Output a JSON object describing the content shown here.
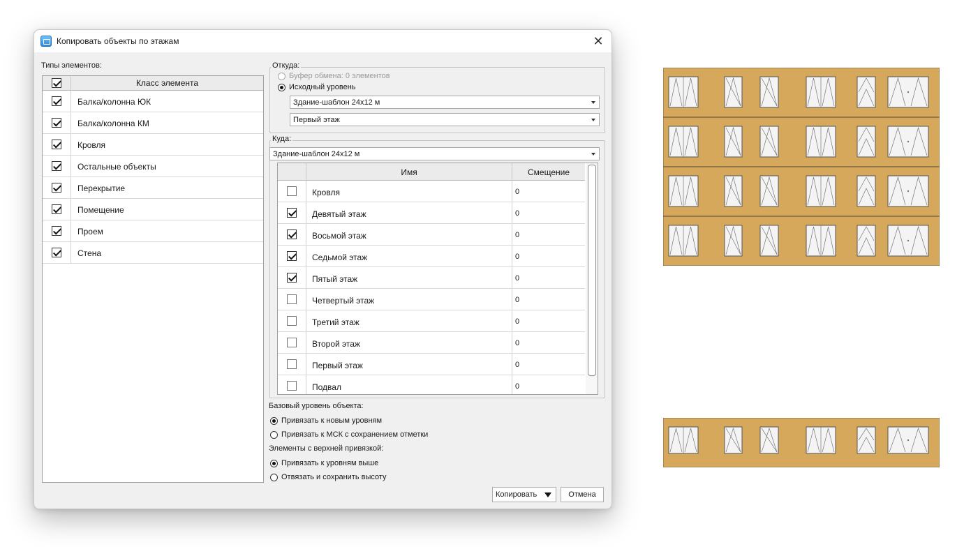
{
  "dialog": {
    "title": "Копировать объекты по этажам",
    "close_icon": "close-icon"
  },
  "types": {
    "label": "Типы элементов:",
    "column_header": "Класс элемента",
    "header_checked": true,
    "items": [
      {
        "label": "Балка/колонна ЮК",
        "checked": true
      },
      {
        "label": "Балка/колонна КМ",
        "checked": true
      },
      {
        "label": "Кровля",
        "checked": true
      },
      {
        "label": "Остальные объекты",
        "checked": true
      },
      {
        "label": "Перекрытие",
        "checked": true
      },
      {
        "label": "Помещение",
        "checked": true
      },
      {
        "label": "Проем",
        "checked": true
      },
      {
        "label": "Стена",
        "checked": true
      }
    ]
  },
  "from": {
    "title": "Откуда:",
    "clipboard_label": "Буфер обмена: 0 элементов",
    "source_level_label": "Исходный уровень",
    "building_value": "Здание-шаблон 24х12 м",
    "floor_value": "Первый этаж"
  },
  "to": {
    "title": "Куда:",
    "building_value": "Здание-шаблон 24х12 м",
    "col_name": "Имя",
    "col_offset": "Смещение",
    "rows": [
      {
        "name": "Кровля",
        "offset": "0",
        "checked": false
      },
      {
        "name": "Девятый этаж",
        "offset": "0",
        "checked": true
      },
      {
        "name": "Восьмой этаж",
        "offset": "0",
        "checked": true
      },
      {
        "name": "Седьмой этаж",
        "offset": "0",
        "checked": true
      },
      {
        "name": "Пятый этаж",
        "offset": "0",
        "checked": true
      },
      {
        "name": "Четвертый этаж",
        "offset": "0",
        "checked": false
      },
      {
        "name": "Третий этаж",
        "offset": "0",
        "checked": false
      },
      {
        "name": "Второй этаж",
        "offset": "0",
        "checked": false
      },
      {
        "name": "Первый этаж",
        "offset": "0",
        "checked": false
      },
      {
        "name": "Подвал",
        "offset": "0",
        "checked": false
      }
    ]
  },
  "base_level": {
    "label": "Базовый уровень объекта:",
    "opt_new_levels": "Привязать к новым уровням",
    "opt_msk": "Привязать к МСК с сохранением отметки"
  },
  "top_binding": {
    "label": "Элементы с верхней привязкой:",
    "opt_above": "Привязать к уровням выше",
    "opt_detach": "Отвязать и сохранить высоту"
  },
  "buttons": {
    "copy": "Копировать",
    "cancel": "Отмена"
  },
  "colors": {
    "facade_fill": "#d6a85c",
    "dialog_bg": "#f0f0f0"
  }
}
